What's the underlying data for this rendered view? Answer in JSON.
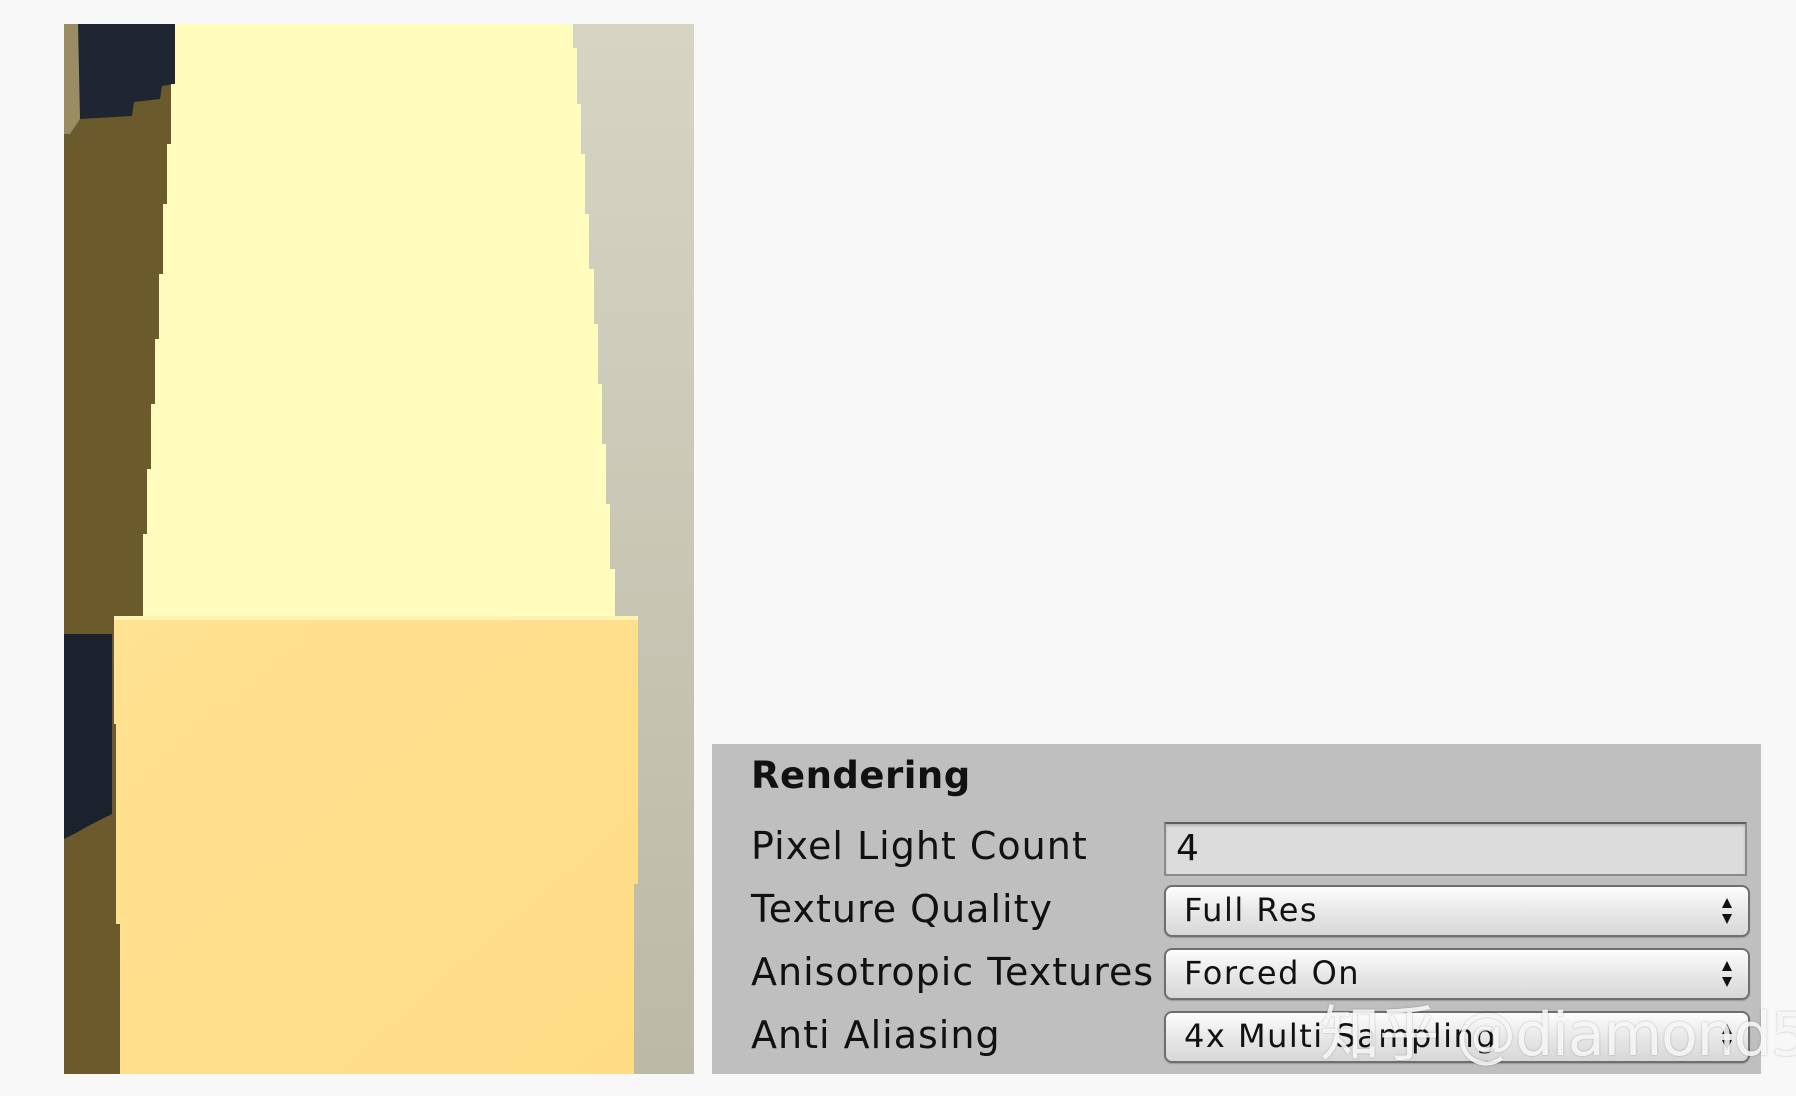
{
  "rendering_panel": {
    "title": "Rendering",
    "pixel_light_count": {
      "label": "Pixel Light Count",
      "value": "4"
    },
    "texture_quality": {
      "label": "Texture Quality",
      "value": "Full Res"
    },
    "anisotropic_textures": {
      "label": "Anisotropic Textures",
      "value": "Forced On"
    },
    "anti_aliasing": {
      "label": "Anti Aliasing",
      "value": "4x Multi Sampling"
    }
  },
  "watermark": "知乎 @diamond5",
  "colors": {
    "panel_bg": "#bfbfbf",
    "light_cone": "#fffcbf",
    "cube_face": "#ffdf8c",
    "shadow_olive": "#6e5d2c",
    "dark_navy": "#1e2430",
    "wall_gray": "#c9c7b5"
  },
  "icons": {
    "dropdown_arrow": "up-down-arrows-icon"
  }
}
